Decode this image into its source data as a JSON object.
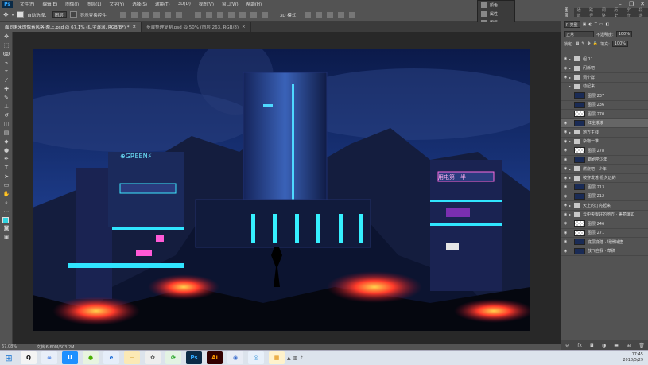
{
  "menubar": {
    "logo": "Ps",
    "items": [
      "文件(F)",
      "编辑(E)",
      "图像(I)",
      "图层(L)",
      "文字(Y)",
      "选择(S)",
      "滤镜(T)",
      "3D(D)",
      "视图(V)",
      "窗口(W)",
      "帮助(H)"
    ]
  },
  "options": {
    "auto_select_label": "自动选择：",
    "auto_select_value": "图层",
    "show_transform_label": "显示变换控件",
    "mode_3d_label": "3D 模式："
  },
  "float_panel": {
    "items": [
      "颜色",
      "属性",
      "图层"
    ]
  },
  "tabs": [
    {
      "label": "面向未来的像素风格-晚上.psd @ 67.1% (红尘滚滚, RGB/8*) *",
      "active": true
    },
    {
      "label": "步骤整理复制.psd @ 50% (图层 263, RGB/8)",
      "active": false
    }
  ],
  "status": {
    "zoom": "67.08%",
    "doc": "文档:6.60M/603.2M"
  },
  "right_panel": {
    "tabs": [
      "图层",
      "通道",
      "路径",
      "调整",
      "历史",
      "字符",
      "段落"
    ],
    "kind_label": "P 类型",
    "blend": "正常",
    "opacity_label": "不透明度:",
    "opacity": "100%",
    "lock_label": "锁定:",
    "fill_label": "填充:",
    "fill": "100%",
    "layers": [
      {
        "name": "组 11",
        "type": "group",
        "visible": true,
        "selected": false
      },
      {
        "name": "闪烁吧",
        "type": "group",
        "visible": true,
        "selected": false
      },
      {
        "name": "调个群",
        "type": "group",
        "visible": true,
        "selected": false
      },
      {
        "name": "动起来",
        "type": "group",
        "visible": false,
        "selected": false
      },
      {
        "name": "图层 237",
        "type": "layer",
        "visible": false,
        "selected": false
      },
      {
        "name": "图层 236",
        "type": "layer",
        "visible": false,
        "selected": false
      },
      {
        "name": "图层 270",
        "type": "checker",
        "visible": false,
        "selected": false
      },
      {
        "name": "红尘滚滚",
        "type": "layer",
        "visible": true,
        "selected": true
      },
      {
        "name": "地方主线",
        "type": "group",
        "visible": true,
        "selected": false
      },
      {
        "name": "杂物一堆",
        "type": "group",
        "visible": true,
        "selected": false
      },
      {
        "name": "图层 278",
        "type": "checker",
        "visible": true,
        "selected": false
      },
      {
        "name": "霸刷吧少年",
        "type": "layer",
        "visible": true,
        "selected": false
      },
      {
        "name": "燃烧吧 · 少年",
        "type": "group",
        "visible": true,
        "selected": false
      },
      {
        "name": "被穿发着·很久远的",
        "type": "group",
        "visible": true,
        "selected": false
      },
      {
        "name": "图层 213",
        "type": "layer",
        "visible": true,
        "selected": false
      },
      {
        "name": "图层 212",
        "type": "layer",
        "visible": true,
        "selected": false
      },
      {
        "name": "天上的灯亮起来",
        "type": "group",
        "visible": true,
        "selected": false
      },
      {
        "name": "云中央很好的地方 · 美丽爆如",
        "type": "group",
        "visible": true,
        "selected": false
      },
      {
        "name": "图层 246",
        "type": "checker",
        "visible": true,
        "selected": false
      },
      {
        "name": "图层 271",
        "type": "checker",
        "visible": true,
        "selected": false
      },
      {
        "name": "底层底建 · 场景铺垫",
        "type": "layer",
        "visible": true,
        "selected": false
      },
      {
        "name": "放飞自我 · 草稿",
        "type": "layer",
        "visible": true,
        "selected": false
      }
    ]
  },
  "scene": {
    "sign_left": "⊕GREEN⚡",
    "sign_right": "用电第一半"
  },
  "taskbar": {
    "apps": [
      {
        "label": "Q",
        "color": "#111",
        "bg": "#f4f4f4"
      },
      {
        "label": "∞",
        "color": "#2266dd",
        "bg": "#e8eef8"
      },
      {
        "label": "U",
        "color": "#fff",
        "bg": "#1e90ff"
      },
      {
        "label": "●",
        "color": "#48b000",
        "bg": "#e8f4e0"
      },
      {
        "label": "e",
        "color": "#1e6fd8",
        "bg": "#e6eefa"
      },
      {
        "label": "▭",
        "color": "#c98a00",
        "bg": "#fbe9b5"
      },
      {
        "label": "✿",
        "color": "#555",
        "bg": "#eee"
      },
      {
        "label": "⟳",
        "color": "#19a019",
        "bg": "#e3f3e3"
      },
      {
        "label": "Ps",
        "color": "#31a8ff",
        "bg": "#0b2a46"
      },
      {
        "label": "Ai",
        "color": "#ff9a00",
        "bg": "#330000"
      },
      {
        "label": "◉",
        "color": "#3a6ccd",
        "bg": "#e8ecf5"
      },
      {
        "label": "◎",
        "color": "#2a8fd8",
        "bg": "#e8f0fa"
      },
      {
        "label": "▦",
        "color": "#e08a00",
        "bg": "#fff2cc"
      }
    ],
    "time": "17:45",
    "date": "2018/5/29"
  }
}
